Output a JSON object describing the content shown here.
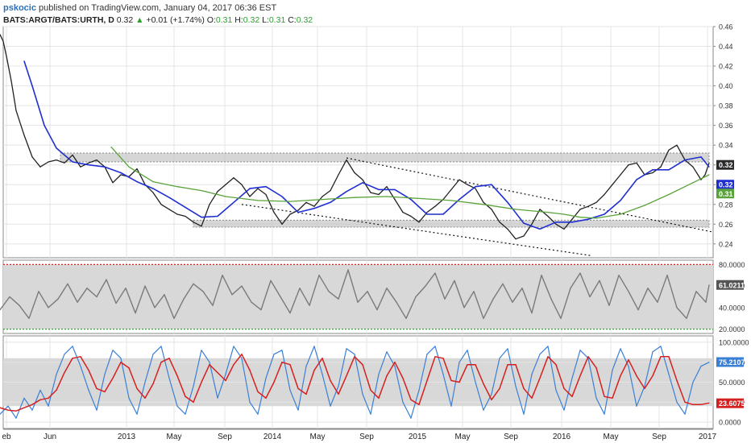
{
  "header": {
    "author": "pskocic",
    "published_text": "published on TradingView.com, January 04, 2017 06:36 EST",
    "symbol": "BATS:ARGT/BATS:URTH, D",
    "last": "0.32",
    "change": "+0.01 (+1.74%)",
    "o_label": "O:",
    "o_value": "0.31",
    "h_label": "H:",
    "h_value": "0.32",
    "l_label": "L:",
    "l_value": "0.31",
    "c_label": "C:",
    "c_value": "0.32"
  },
  "colors": {
    "price": "#222222",
    "ma_fast": "#1f2fd0",
    "ma_slow": "#5aa33a",
    "rsi": "#7a7a7a",
    "stoch_k": "#3a7fd6",
    "stoch_d": "#d62020",
    "zone_fill": "#c4c4c4",
    "overbought": "#e02020",
    "oversold": "#3a9a3a",
    "label_current": "#2a2a2a"
  },
  "chart_data": [
    {
      "type": "line",
      "panel": "price",
      "x_ticks": [
        "eb",
        "Jun",
        "2013",
        "May",
        "Sep",
        "2014",
        "May",
        "Sep",
        "2015",
        "May",
        "Sep",
        "2016",
        "May",
        "Sep",
        "2017"
      ],
      "y_ticks": [
        "0.46",
        "0.44",
        "0.42",
        "0.40",
        "0.38",
        "0.36",
        "0.34",
        "0.32",
        "0.30",
        "0.28",
        "0.26",
        "0.24"
      ],
      "ylim": [
        0.226,
        0.46
      ],
      "series": [
        {
          "role": "price",
          "x": [
            0,
            4,
            8,
            14,
            20,
            30,
            40,
            50,
            60,
            70,
            80,
            90,
            100,
            110,
            120,
            130,
            140,
            150,
            160,
            170,
            180,
            190,
            200,
            210,
            220,
            230,
            240,
            250,
            260,
            270,
            280,
            290,
            300,
            310,
            320,
            330,
            340,
            350,
            360,
            370,
            380,
            390,
            400,
            410,
            420,
            430,
            440,
            450,
            460,
            470,
            480,
            490,
            500,
            510,
            520,
            530,
            540,
            550,
            560,
            570,
            580,
            590,
            600,
            610,
            620,
            630,
            640,
            650,
            660,
            670,
            680,
            690,
            700,
            710,
            720,
            730,
            740,
            750,
            760,
            770,
            780,
            790,
            800,
            810,
            820,
            830,
            840,
            850,
            860,
            870,
            875,
            880
          ],
          "values": [
            0.452,
            0.445,
            0.43,
            0.405,
            0.375,
            0.35,
            0.328,
            0.318,
            0.323,
            0.325,
            0.322,
            0.33,
            0.318,
            0.322,
            0.325,
            0.318,
            0.302,
            0.31,
            0.308,
            0.316,
            0.3,
            0.292,
            0.28,
            0.275,
            0.27,
            0.268,
            0.262,
            0.258,
            0.28,
            0.293,
            0.3,
            0.307,
            0.3,
            0.288,
            0.296,
            0.29,
            0.272,
            0.26,
            0.27,
            0.274,
            0.282,
            0.278,
            0.288,
            0.294,
            0.31,
            0.325,
            0.312,
            0.305,
            0.292,
            0.29,
            0.298,
            0.285,
            0.272,
            0.268,
            0.262,
            0.272,
            0.278,
            0.285,
            0.295,
            0.305,
            0.3,
            0.296,
            0.282,
            0.275,
            0.262,
            0.255,
            0.245,
            0.248,
            0.26,
            0.275,
            0.268,
            0.26,
            0.255,
            0.265,
            0.275,
            0.278,
            0.282,
            0.29,
            0.3,
            0.31,
            0.32,
            0.322,
            0.31,
            0.312,
            0.318,
            0.335,
            0.34,
            0.325,
            0.318,
            0.305,
            0.31,
            0.322
          ]
        },
        {
          "role": "ma_fast",
          "x": [
            30,
            40,
            55,
            70,
            90,
            110,
            130,
            150,
            170,
            190,
            210,
            230,
            250,
            270,
            290,
            310,
            330,
            350,
            370,
            390,
            410,
            430,
            450,
            470,
            490,
            510,
            530,
            550,
            570,
            590,
            610,
            630,
            650,
            670,
            690,
            710,
            730,
            750,
            770,
            790,
            810,
            830,
            850,
            870,
            880
          ],
          "values": [
            0.425,
            0.4,
            0.36,
            0.337,
            0.323,
            0.32,
            0.318,
            0.312,
            0.303,
            0.296,
            0.287,
            0.277,
            0.267,
            0.268,
            0.282,
            0.296,
            0.298,
            0.288,
            0.272,
            0.276,
            0.282,
            0.293,
            0.302,
            0.295,
            0.295,
            0.285,
            0.27,
            0.27,
            0.285,
            0.298,
            0.3,
            0.282,
            0.261,
            0.255,
            0.262,
            0.262,
            0.265,
            0.27,
            0.284,
            0.305,
            0.315,
            0.315,
            0.325,
            0.328,
            0.318
          ]
        },
        {
          "role": "ma_slow",
          "x": [
            138,
            160,
            190,
            220,
            250,
            280,
            320,
            360,
            400,
            440,
            480,
            520,
            560,
            600,
            640,
            680,
            700,
            720,
            740,
            770,
            800,
            830,
            860,
            880
          ],
          "values": [
            0.338,
            0.318,
            0.303,
            0.298,
            0.294,
            0.288,
            0.284,
            0.283,
            0.285,
            0.287,
            0.288,
            0.286,
            0.284,
            0.28,
            0.275,
            0.272,
            0.27,
            0.267,
            0.266,
            0.27,
            0.279,
            0.29,
            0.302,
            0.31
          ]
        }
      ],
      "zones": [
        {
          "from": 0.323,
          "to": 0.332,
          "x_start": 75,
          "x_end": 880
        },
        {
          "from": 0.257,
          "to": 0.264,
          "x_start": 240,
          "x_end": 880
        }
      ],
      "trendlines": [
        {
          "x1": 430,
          "y1": 0.327,
          "x2": 885,
          "y2": 0.252
        },
        {
          "x1": 300,
          "y1": 0.28,
          "x2": 735,
          "y2": 0.228
        }
      ],
      "last_labels": [
        {
          "text": "0.32",
          "value": 0.32,
          "role": "price"
        },
        {
          "text": "0.32",
          "value": 0.3,
          "role": "ma_fast"
        },
        {
          "text": "0.31",
          "value": 0.291,
          "role": "ma_slow"
        }
      ]
    },
    {
      "type": "line",
      "panel": "rsi",
      "y_ticks": [
        "80.0000",
        "60.0000",
        "40.0000",
        "20.0000"
      ],
      "ylim": [
        16,
        84
      ],
      "band": [
        20,
        80
      ],
      "last_label": {
        "text": "61.0211",
        "value": 61.0211
      },
      "series": [
        {
          "role": "rsi",
          "x": [
            0,
            12,
            24,
            36,
            48,
            60,
            72,
            84,
            96,
            108,
            120,
            132,
            144,
            156,
            168,
            180,
            192,
            204,
            216,
            228,
            240,
            252,
            264,
            276,
            288,
            300,
            312,
            324,
            336,
            348,
            360,
            372,
            384,
            396,
            408,
            420,
            432,
            444,
            456,
            468,
            480,
            492,
            504,
            516,
            528,
            540,
            552,
            564,
            576,
            588,
            600,
            612,
            624,
            636,
            648,
            660,
            672,
            684,
            696,
            708,
            720,
            732,
            744,
            756,
            768,
            780,
            792,
            804,
            816,
            828,
            840,
            852,
            864,
            876,
            880
          ],
          "values": [
            38,
            50,
            42,
            30,
            55,
            40,
            48,
            62,
            45,
            58,
            50,
            66,
            44,
            58,
            35,
            60,
            40,
            52,
            30,
            48,
            62,
            55,
            42,
            70,
            52,
            60,
            45,
            38,
            65,
            50,
            35,
            58,
            42,
            70,
            55,
            48,
            75,
            45,
            55,
            38,
            58,
            45,
            30,
            50,
            60,
            72,
            48,
            65,
            40,
            55,
            30,
            48,
            62,
            45,
            58,
            35,
            70,
            48,
            30,
            58,
            72,
            50,
            65,
            42,
            70,
            55,
            38,
            58,
            45,
            70,
            40,
            30,
            55,
            45,
            61
          ]
        }
      ]
    },
    {
      "type": "line",
      "panel": "stochastic",
      "y_ticks": [
        "100.0000",
        "75.0000",
        "50.0000",
        "25.0000",
        "0.0000"
      ],
      "ylim": [
        -8,
        108
      ],
      "band": [
        20,
        80
      ],
      "last_labels": [
        {
          "text": "75.2107",
          "value": 75.2107,
          "role": "stoch_k"
        },
        {
          "text": "23.6075",
          "value": 23.6075,
          "role": "stoch_d"
        }
      ],
      "series": [
        {
          "role": "stoch_k",
          "x": [
            0,
            10,
            20,
            30,
            40,
            50,
            60,
            70,
            80,
            90,
            100,
            110,
            120,
            130,
            140,
            150,
            160,
            170,
            180,
            190,
            200,
            210,
            220,
            230,
            240,
            250,
            260,
            270,
            280,
            290,
            300,
            310,
            320,
            330,
            340,
            350,
            360,
            370,
            380,
            390,
            400,
            410,
            420,
            430,
            440,
            450,
            460,
            470,
            480,
            490,
            500,
            510,
            520,
            530,
            540,
            550,
            560,
            570,
            580,
            590,
            600,
            610,
            620,
            630,
            640,
            650,
            660,
            670,
            680,
            690,
            700,
            710,
            720,
            730,
            740,
            750,
            760,
            770,
            780,
            790,
            800,
            810,
            820,
            830,
            840,
            850,
            860,
            870,
            880
          ],
          "values": [
            10,
            20,
            5,
            30,
            15,
            40,
            20,
            60,
            85,
            95,
            70,
            40,
            15,
            60,
            90,
            80,
            30,
            10,
            50,
            85,
            95,
            55,
            20,
            10,
            45,
            90,
            75,
            30,
            60,
            95,
            80,
            25,
            10,
            55,
            85,
            90,
            40,
            15,
            70,
            95,
            60,
            20,
            45,
            92,
            85,
            35,
            10,
            60,
            88,
            70,
            25,
            5,
            40,
            85,
            95,
            60,
            20,
            75,
            90,
            50,
            15,
            35,
            80,
            92,
            45,
            10,
            60,
            85,
            95,
            40,
            15,
            55,
            90,
            80,
            30,
            10,
            65,
            92,
            70,
            20,
            45,
            88,
            95,
            60,
            25,
            10,
            50,
            70,
            75
          ]
        },
        {
          "role": "stoch_d",
          "x": [
            0,
            10,
            20,
            30,
            40,
            50,
            60,
            70,
            80,
            90,
            100,
            110,
            120,
            130,
            140,
            150,
            160,
            170,
            180,
            190,
            200,
            210,
            220,
            230,
            240,
            250,
            260,
            270,
            280,
            290,
            300,
            310,
            320,
            330,
            340,
            350,
            360,
            370,
            380,
            390,
            400,
            410,
            420,
            430,
            440,
            450,
            460,
            470,
            480,
            490,
            500,
            510,
            520,
            530,
            540,
            550,
            560,
            570,
            580,
            590,
            600,
            610,
            620,
            630,
            640,
            650,
            660,
            670,
            680,
            690,
            700,
            710,
            720,
            730,
            740,
            750,
            760,
            770,
            780,
            790,
            800,
            810,
            820,
            830,
            840,
            850,
            860,
            870,
            880
          ],
          "values": [
            18,
            15,
            14,
            18,
            22,
            28,
            30,
            40,
            62,
            80,
            82,
            65,
            42,
            38,
            55,
            75,
            68,
            42,
            30,
            48,
            75,
            80,
            58,
            32,
            25,
            50,
            72,
            62,
            52,
            72,
            85,
            65,
            38,
            30,
            50,
            75,
            72,
            42,
            35,
            65,
            80,
            52,
            35,
            58,
            82,
            72,
            40,
            30,
            58,
            75,
            55,
            28,
            22,
            52,
            82,
            80,
            52,
            50,
            72,
            72,
            48,
            28,
            42,
            72,
            72,
            42,
            30,
            55,
            82,
            72,
            42,
            32,
            58,
            82,
            68,
            32,
            30,
            58,
            78,
            58,
            42,
            58,
            82,
            82,
            52,
            25,
            22,
            22,
            24
          ]
        }
      ]
    }
  ]
}
